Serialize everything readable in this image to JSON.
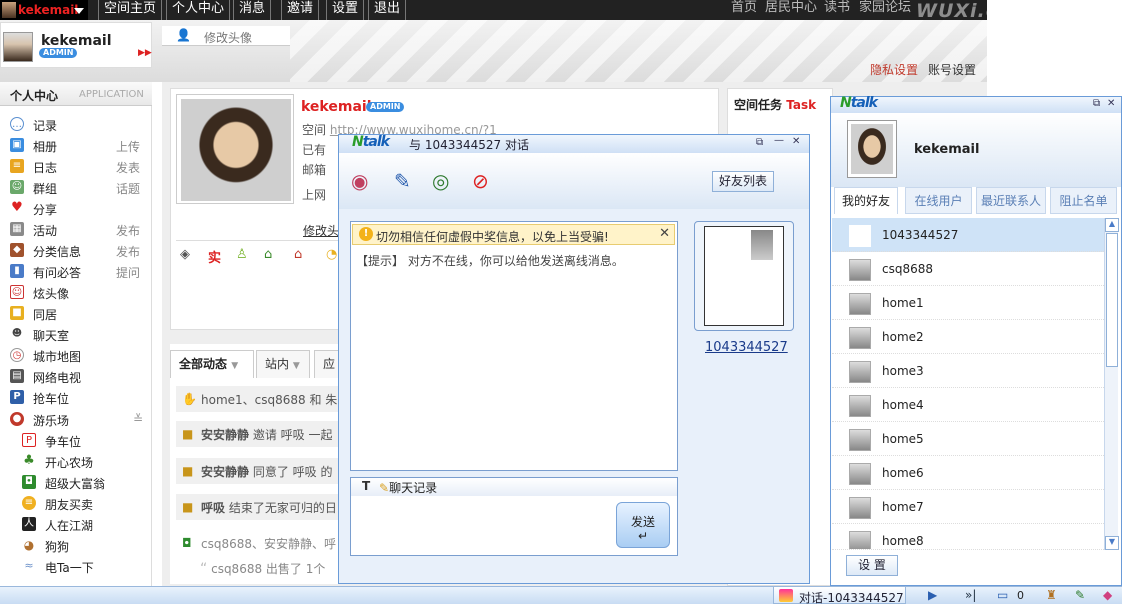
{
  "topnav": {
    "username": "kekemail",
    "items": [
      "空间主页",
      "个人中心",
      "消息",
      "邀请",
      "设置",
      "退出"
    ],
    "links": [
      "首页",
      "居民中心",
      "读书",
      "家园论坛"
    ],
    "logo": "WUXi.c"
  },
  "header": {
    "username": "kekemail",
    "badge": "ADMIN",
    "change_avatar": "修改头像",
    "privacy_settings": "隐私设置",
    "account_settings": "账号设置"
  },
  "sidebar": {
    "title": "个人中心",
    "title_en": "APPLICATION",
    "items": [
      {
        "label": "记录",
        "extra": ""
      },
      {
        "label": "相册",
        "extra": "上传"
      },
      {
        "label": "日志",
        "extra": "发表"
      },
      {
        "label": "群组",
        "extra": "话题"
      },
      {
        "label": "分享",
        "extra": ""
      },
      {
        "label": "活动",
        "extra": "发布"
      },
      {
        "label": "分类信息",
        "extra": "发布"
      },
      {
        "label": "有问必答",
        "extra": "提问"
      },
      {
        "label": "炫头像",
        "extra": ""
      },
      {
        "label": "同居",
        "extra": ""
      },
      {
        "label": "聊天室",
        "extra": ""
      },
      {
        "label": "城市地图",
        "extra": ""
      },
      {
        "label": "网络电视",
        "extra": ""
      },
      {
        "label": "抢车位",
        "extra": ""
      },
      {
        "label": "游乐场",
        "extra": ""
      }
    ],
    "sub_items": [
      "争车位",
      "开心农场",
      "超级大富翁",
      "朋友买卖",
      "人在江湖",
      "狗狗",
      "电Ta一下"
    ]
  },
  "profile": {
    "name": "kekemail",
    "badge": "ADMIN",
    "space_label": "空间",
    "space_url": "http://www.wuxihome.cn/?1",
    "has_label": "已有",
    "mail_label": "邮箱",
    "online_label": "上网",
    "edit_link": "修改头"
  },
  "feed": {
    "tabs": [
      "全部动态",
      "站内",
      "应"
    ],
    "items": [
      {
        "user": "",
        "text": "home1、csq8688 和 朱"
      },
      {
        "user": "安安静静",
        "text": "邀请 呼吸 一起"
      },
      {
        "user": "安安静静",
        "text": "同意了 呼吸 的"
      },
      {
        "user": "呼吸",
        "text": "结束了无家可归的日"
      },
      {
        "user": "",
        "text": "csq8688、安安静静、呼"
      }
    ],
    "quote": "csq8688 出售了 1个"
  },
  "task": {
    "title": "空间任务",
    "title_en": "Task"
  },
  "chat": {
    "logo": "Ntalk",
    "title_prefix": "与",
    "peer": "1043344527",
    "title_suffix": "对话",
    "friend_list_button": "好友列表",
    "warning": "切勿相信任何虚假中奖信息，以免上当受骗!",
    "tip": "【提示】 对方不在线，你可以给他发送离线消息。",
    "font_button": "T",
    "history_button": "聊天记录",
    "send_button": "发送",
    "send_icon": "↵"
  },
  "ntalk": {
    "logo": "Ntalk",
    "username": "kekemail",
    "tabs": [
      "我的好友",
      "在线用户",
      "最近联系人",
      "阻止名单"
    ],
    "friends": [
      "1043344527",
      "csq8688",
      "home1",
      "home2",
      "home3",
      "home4",
      "home5",
      "home6",
      "home7",
      "home8"
    ],
    "settings_button": "设 置"
  },
  "statusbar": {
    "chat_task": "对话-1043344527",
    "message_count": "0"
  }
}
